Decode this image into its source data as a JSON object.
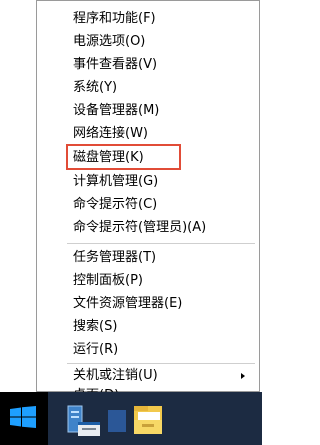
{
  "menu": {
    "groups": [
      [
        {
          "label": "程序和功能(F)"
        },
        {
          "label": "电源选项(O)"
        },
        {
          "label": "事件查看器(V)"
        },
        {
          "label": "系统(Y)"
        },
        {
          "label": "设备管理器(M)"
        },
        {
          "label": "网络连接(W)"
        },
        {
          "label": "磁盘管理(K)"
        },
        {
          "label": "计算机管理(G)"
        },
        {
          "label": "命令提示符(C)"
        },
        {
          "label": "命令提示符(管理员)(A)"
        }
      ],
      [
        {
          "label": "任务管理器(T)"
        },
        {
          "label": "控制面板(P)"
        },
        {
          "label": "文件资源管理器(E)"
        },
        {
          "label": "搜索(S)"
        },
        {
          "label": "运行(R)"
        }
      ],
      [
        {
          "label": "关机或注销(U)",
          "has_submenu": true
        },
        {
          "label": "桌面(D)"
        }
      ]
    ],
    "highlighted_item": "磁盘管理(K)",
    "highlight_color": "#e14c37"
  },
  "taskbar": {
    "background": "#1c2b42",
    "icons": [
      "windows-logo-icon",
      "server-manager-icon",
      "powershell-icon",
      "file-explorer-icon"
    ]
  }
}
